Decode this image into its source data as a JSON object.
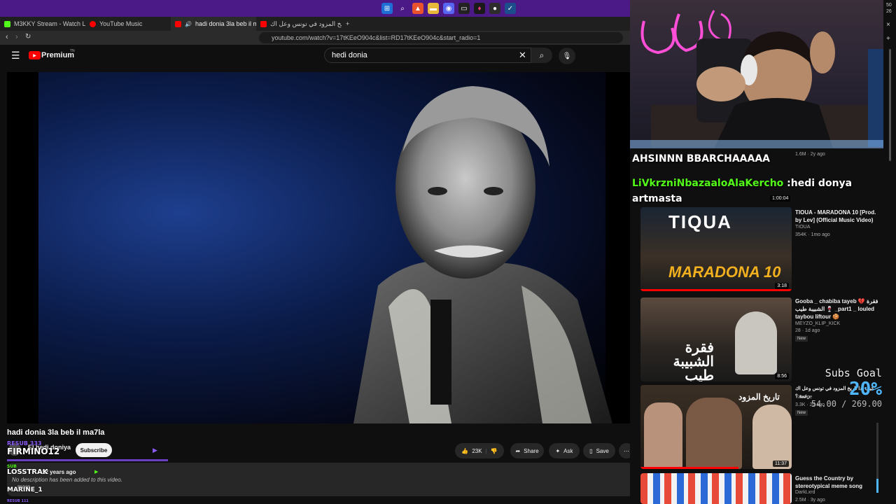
{
  "taskbar": {
    "time": "50",
    "date": "26"
  },
  "tabs": [
    {
      "label": "M3KKY Stream - Watch Live on Kick",
      "color": "#53fc18"
    },
    {
      "label": "YouTube Music",
      "color": "#ff0000"
    },
    {
      "label": "hadi donia 3la beb il ma7la -",
      "color": "#ff0000",
      "active": true
    },
    {
      "label": "كيف بدا تاريخ المزود في تونس وعل اك",
      "color": "#ff0000"
    }
  ],
  "address": {
    "url": "youtube.com/watch?v=17tKEeO904c&list=RD17tKEeO904c&start_radio=1"
  },
  "header": {
    "brand": "Premium",
    "brand_sup": "TN",
    "search_value": "hedi donia"
  },
  "video": {
    "title": "hadi donia 3la beb il ma7la"
  },
  "channel": {
    "name": "El hedi doniya",
    "subscribe": "Subscribe"
  },
  "overlay": {
    "resub": "RESUB 333",
    "user1": "FIRMINO12",
    "user2": "LOSSTRAK",
    "user3": "MARINE_1",
    "sub_label": "SUB",
    "resub_label": "RESUB 111"
  },
  "actions": {
    "likes": "23K",
    "share": "Share",
    "ask": "Ask",
    "save": "Save"
  },
  "description": {
    "meta": "12 years ago",
    "text": "No description has been added to this video.",
    "more": "more"
  },
  "chat": {
    "msg1": "AHSINNN BBARCHAAAAA",
    "user2": "LiVkrzniNbazaaloAlaKercho",
    "msg2": ":hedi donya",
    "msg3": "artmasta"
  },
  "related": [
    {
      "meta": "1.6M · 2y ago",
      "duration": "1:00:04"
    },
    {
      "title": "TIOUA - MARADONA 10 [Prod. by Lev] (Official Music Video)",
      "channel": "TIOUA",
      "meta": "354K · 1mo ago",
      "duration": "3:18",
      "thumb_text": "MARADONA 10",
      "thumb_top": "TIQUA"
    },
    {
      "title": "Gooba _ chabiba tayeb 💔 فقرة الشبيبة طيب 🍷 _part1 _ louled taybou liftour 🍪",
      "channel": "MEYZO_KLIP_KICK",
      "meta": "28 · 1d ago",
      "badge": "New",
      "duration": "8:56",
      "thumb_text": "فقرة الشبيبة طيب"
    },
    {
      "title": "كيف بدا تاريخ المزود في تونس وعل اك زعمة ؟",
      "channel": "Yassine",
      "meta": "3.3K · 2d ago",
      "badge": "New",
      "duration": "11:37",
      "thumb_text": "تاريخ المزود"
    },
    {
      "title": "Guess the Country by stereotypical meme song",
      "channel": "DarkLxrd",
      "meta": "2.5M · 3y ago"
    }
  ],
  "goal": {
    "label": "Subs Goal",
    "percent": "20%",
    "current": "54.00",
    "target": "269.00",
    "fraction": 0.2
  },
  "colors": {
    "accent": "#ff0000",
    "taskbar": "#4b1a86",
    "goal": "#4fb7ff"
  }
}
